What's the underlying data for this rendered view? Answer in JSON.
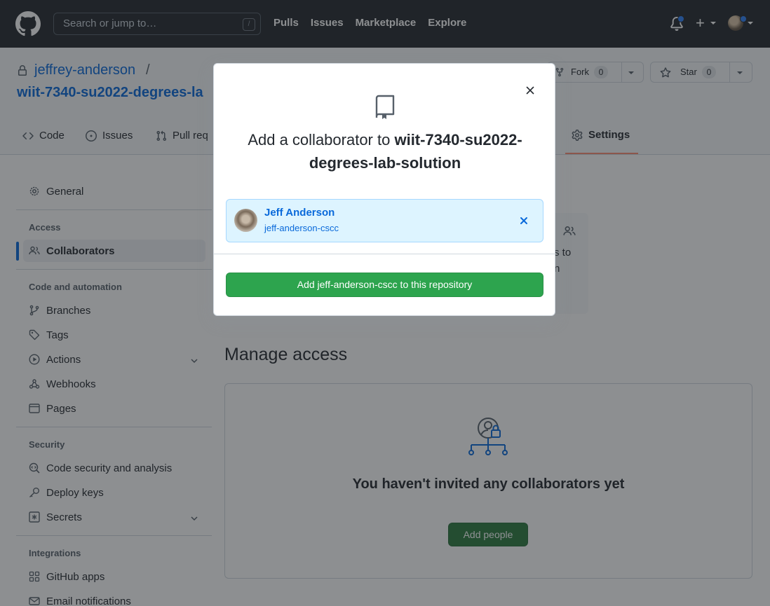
{
  "header": {
    "search_placeholder": "Search or jump to…",
    "search_shortcut": "/",
    "nav": [
      "Pulls",
      "Issues",
      "Marketplace",
      "Explore"
    ],
    "plus_label": "+"
  },
  "repo": {
    "owner": "jeffrey-anderson",
    "separator": "/",
    "name": "wiit-7340-su2022-degrees-la",
    "fork_label": "Fork",
    "fork_count": "0",
    "star_label": "Star",
    "star_count": "0"
  },
  "tabs": {
    "code": "Code",
    "issues": "Issues",
    "pulls": "Pull req",
    "settings": "Settings"
  },
  "sidebar": {
    "general": "General",
    "access_heading": "Access",
    "collaborators": "Collaborators",
    "code_heading": "Code and automation",
    "branches": "Branches",
    "tags": "Tags",
    "actions": "Actions",
    "webhooks": "Webhooks",
    "pages": "Pages",
    "security_heading": "Security",
    "code_security": "Code security and analysis",
    "deploy_keys": "Deploy keys",
    "secrets": "Secrets",
    "integrations_heading": "Integrations",
    "github_apps": "GitHub apps",
    "email_notifications": "Email notifications"
  },
  "main": {
    "access_text1": "s to",
    "access_text2": "n",
    "manage_title": "Manage access",
    "empty_text": "You haven't invited any collaborators yet",
    "add_people": "Add people"
  },
  "dialog": {
    "title_prefix": "Add a collaborator to ",
    "title_repo": "wiit-7340-su2022-degrees-lab-solution",
    "user_name": "Jeff Anderson",
    "user_login": "jeff-anderson-cscc",
    "add_button": "Add jeff-anderson-cscc to this repository"
  },
  "colors": {
    "header_bg": "#24292f",
    "link": "#0969da",
    "primary_green": "#2da44e",
    "selected_tab_underline": "#fd8c73",
    "notification_dot": "#2f81f7"
  }
}
